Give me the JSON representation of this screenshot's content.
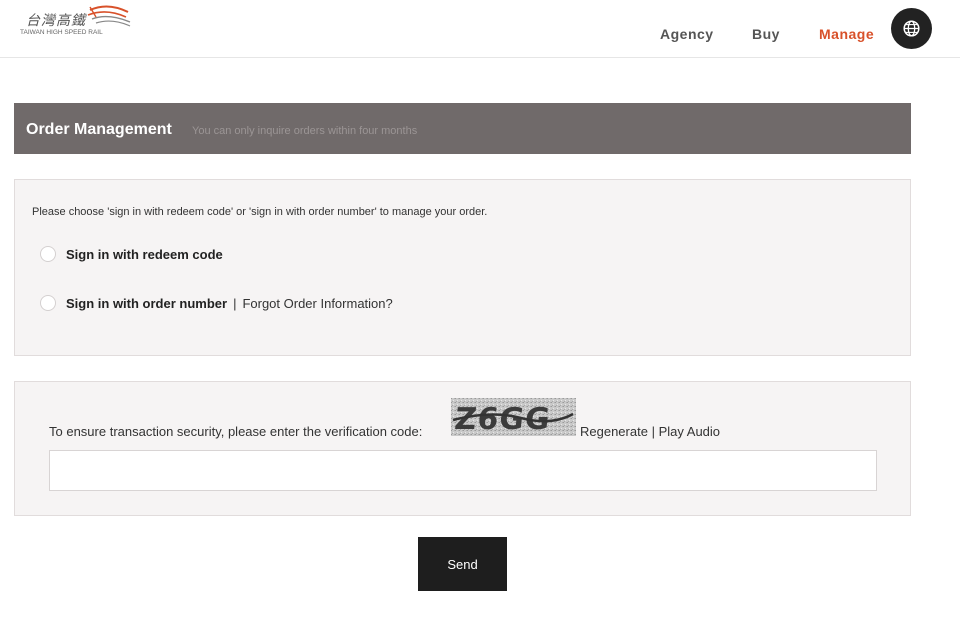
{
  "header": {
    "logo_zh": "台灣高鐵",
    "logo_en": "TAIWAN HIGH SPEED RAIL",
    "nav": [
      {
        "label": "Agency",
        "active": false
      },
      {
        "label": "Buy",
        "active": false
      },
      {
        "label": "Manage",
        "active": true
      }
    ],
    "globe_icon": "globe-icon"
  },
  "title_bar": {
    "title": "Order Management",
    "subtitle": "You can only inquire orders within four months"
  },
  "sign_in": {
    "instruction": "Please choose 'sign in with redeem code' or 'sign in with order number' to manage your order.",
    "option_redeem": "Sign in with redeem code",
    "option_order": "Sign in with order number",
    "separator": "|",
    "forgot_link": "Forgot Order Information?"
  },
  "verification": {
    "prompt": "To ensure transaction security, please enter the verification code:",
    "captcha_text": "Z6GG",
    "regenerate": "Regenerate",
    "separator": "|",
    "play_audio": "Play Audio",
    "input_value": ""
  },
  "send_label": "Send",
  "colors": {
    "accent": "#d8512a",
    "title_bar": "#706a6a",
    "panel_bg": "#f6f4f4",
    "button_bg": "#1e1e1e"
  }
}
